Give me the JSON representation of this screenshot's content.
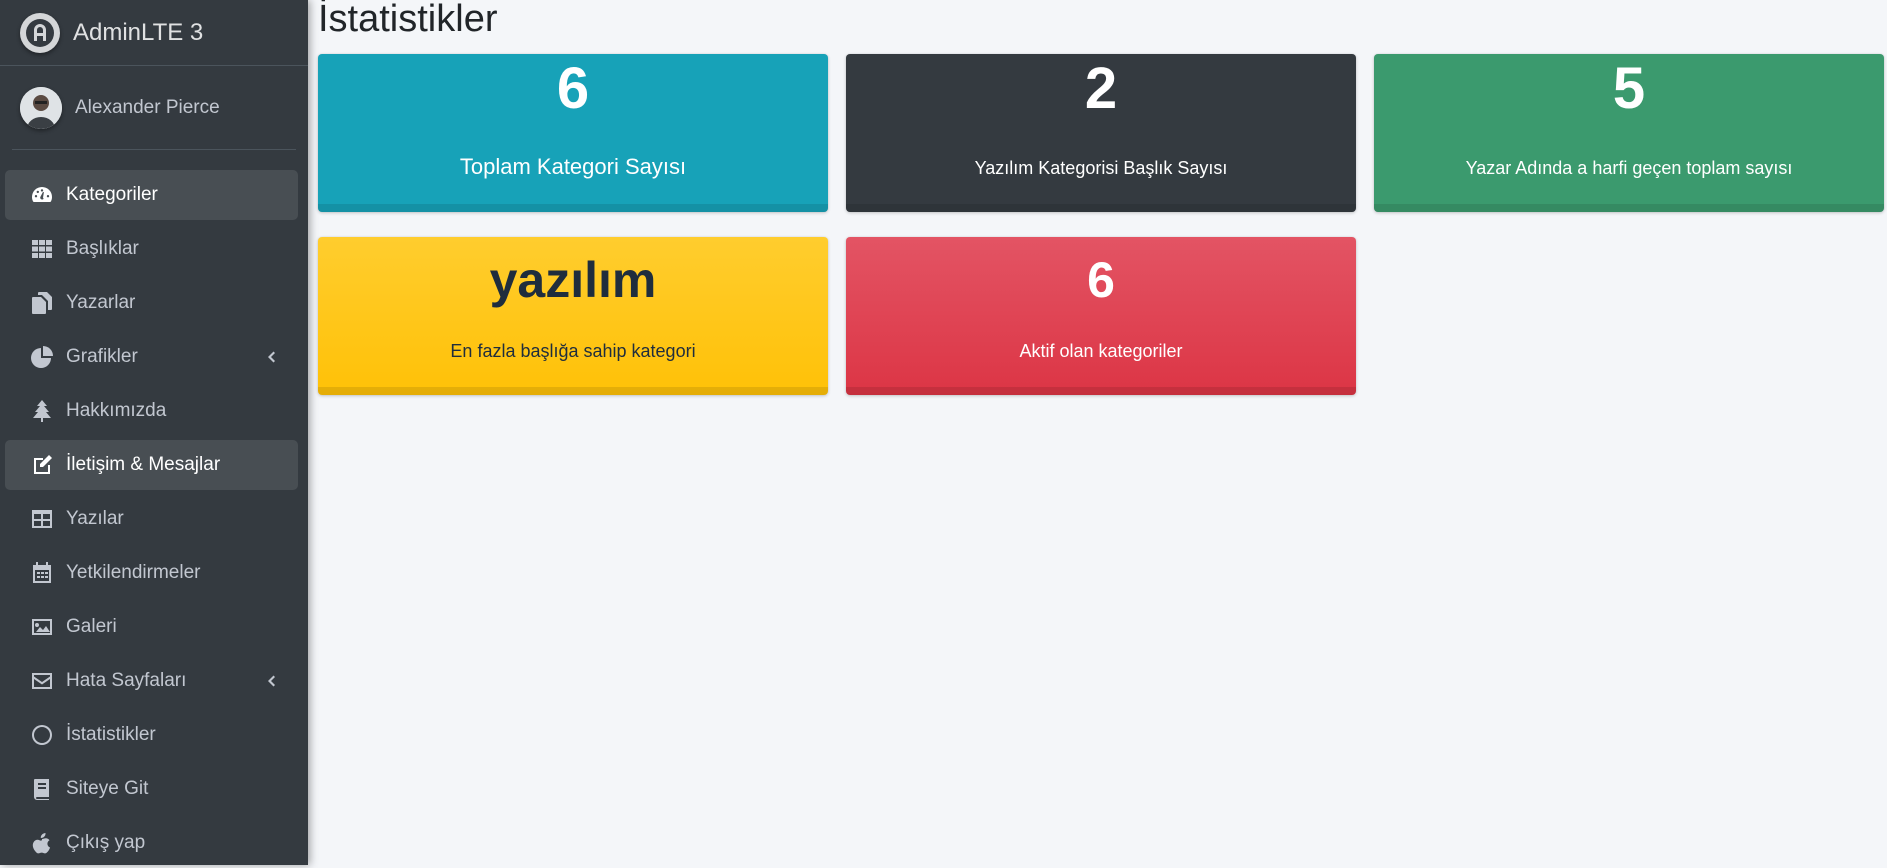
{
  "brand": {
    "title": "AdminLTE 3"
  },
  "user": {
    "name": "Alexander Pierce"
  },
  "sidebar": {
    "items": [
      {
        "label": "Kategoriler",
        "icon": "tachometer-icon"
      },
      {
        "label": "Başlıklar",
        "icon": "grid-icon"
      },
      {
        "label": "Yazarlar",
        "icon": "copy-icon"
      },
      {
        "label": "Grafikler",
        "icon": "pie-chart-icon"
      },
      {
        "label": "Hakkımızda",
        "icon": "tree-icon"
      },
      {
        "label": "İletişim & Mesajlar",
        "icon": "edit-icon"
      },
      {
        "label": "Yazılar",
        "icon": "table-icon"
      },
      {
        "label": "Yetkilendirmeler",
        "icon": "calendar-icon"
      },
      {
        "label": "Galeri",
        "icon": "image-icon"
      },
      {
        "label": "Hata Sayfaları",
        "icon": "envelope-icon"
      },
      {
        "label": "İstatistikler",
        "icon": "circle-icon"
      },
      {
        "label": "Siteye Git",
        "icon": "book-icon"
      },
      {
        "label": "Çıkış yap",
        "icon": "apple-icon"
      }
    ]
  },
  "page": {
    "title": "İstatistikler"
  },
  "stats": [
    {
      "value": "6",
      "label": "Toplam Kategori Sayısı",
      "color": "#17a2b8"
    },
    {
      "value": "2",
      "label": "Yazılım Kategorisi Başlık Sayısı",
      "color": "#343a40"
    },
    {
      "value": "5",
      "label": "Yazar Adında a harfi geçen toplam sayısı",
      "color": "#3b9a6e"
    },
    {
      "value": "yazılım",
      "label": "En fazla başlığa sahip kategori",
      "color": "#ffc107"
    },
    {
      "value": "6",
      "label": "Aktif olan kategoriler",
      "color": "#dc3545"
    }
  ]
}
